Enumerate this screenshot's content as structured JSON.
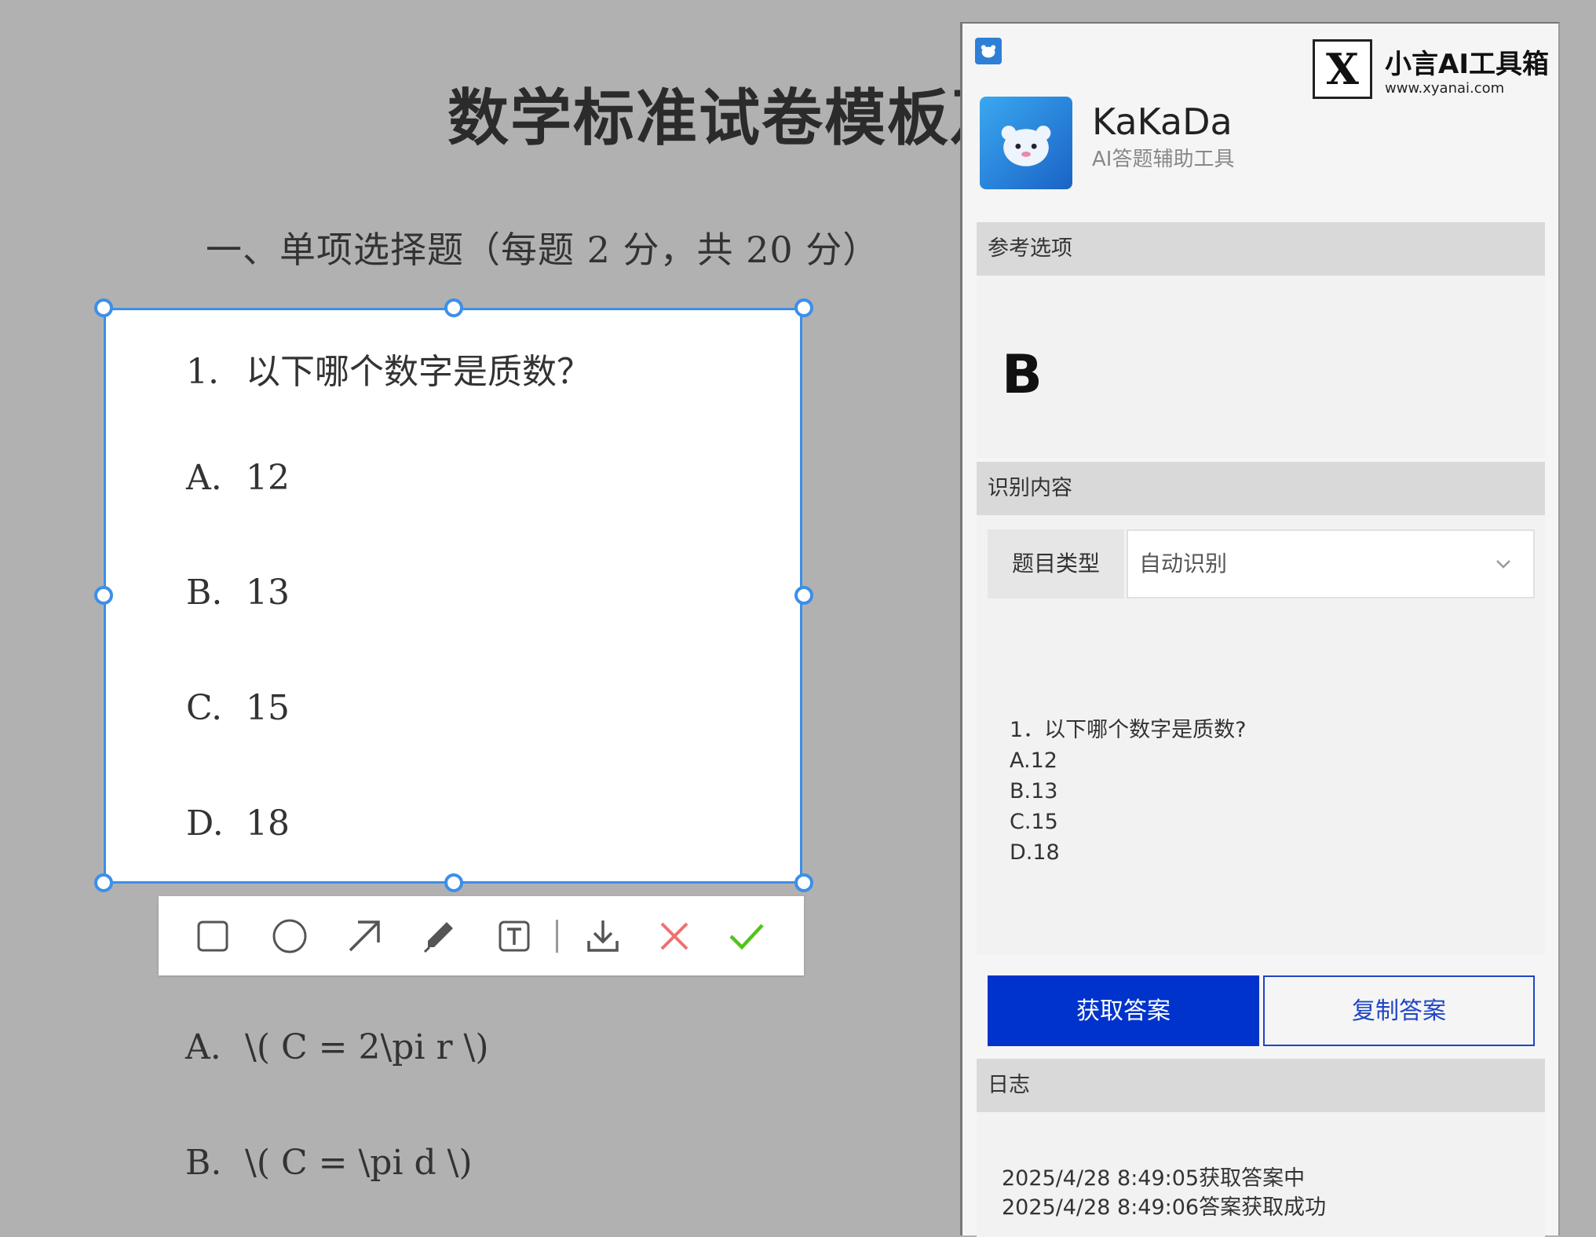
{
  "document": {
    "title": "数学标准试卷模板及",
    "section_heading": "一、单项选择题（每题 2 分，共 20 分）",
    "question": {
      "number": "1.",
      "text": "以下哪个数字是质数？"
    },
    "options": [
      {
        "letter": "A.",
        "value": "12"
      },
      {
        "letter": "B.",
        "value": "13"
      },
      {
        "letter": "C.",
        "value": "15"
      },
      {
        "letter": "D.",
        "value": "18"
      }
    ],
    "next_options": [
      {
        "letter": "A.",
        "value": "\\( C = 2\\pi r \\)"
      },
      {
        "letter": "B.",
        "value": "\\( C = \\pi d \\)"
      }
    ]
  },
  "toolbar": {
    "tools": [
      "rectangle-icon",
      "ellipse-icon",
      "arrow-icon",
      "pen-icon",
      "text-icon",
      "download-icon",
      "cancel-icon",
      "confirm-icon"
    ],
    "colors": {
      "cancel": "#f07070",
      "confirm": "#52c41a"
    }
  },
  "app": {
    "name": "KaKaDa",
    "subtitle": "AI答题辅助工具",
    "accent_color": "#0033cc"
  },
  "watermark": {
    "mark": "X",
    "title": "小言AI工具箱",
    "url": "www.xyanai.com"
  },
  "panel": {
    "reference_header": "参考选项",
    "answer": "B",
    "recognition_header": "识别内容",
    "type_label": "题目类型",
    "type_value": "自动识别",
    "recognized_lines": [
      "1．以下哪个数字是质数?",
      "A.12",
      "B.13",
      "C.15",
      "D.18"
    ],
    "get_answer_label": "获取答案",
    "copy_answer_label": "复制答案",
    "log_header": "日志",
    "log_lines": [
      "2025/4/28 8:49:05获取答案中",
      "2025/4/28 8:49:06答案获取成功"
    ]
  }
}
